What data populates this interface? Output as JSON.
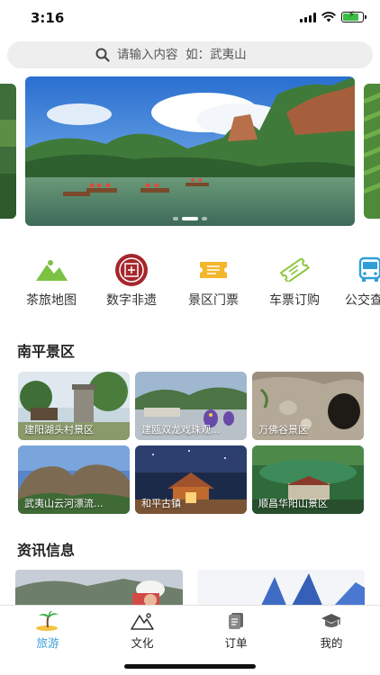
{
  "status_bar": {
    "time": "3:16",
    "battery_level": 0.8
  },
  "search": {
    "placeholder": "请输入内容  如：武夷山",
    "icon": "search-icon"
  },
  "banner": {
    "slide_count": 3,
    "active_slide": 1
  },
  "quick_nav": {
    "items": [
      {
        "label": "茶旅地图",
        "icon": "tea-map-icon",
        "color": "#6dbb3c"
      },
      {
        "label": "数字非遗",
        "icon": "heritage-seal-icon",
        "color": "#a6262c"
      },
      {
        "label": "景区门票",
        "icon": "ticket-icon",
        "color": "#f4b62b"
      },
      {
        "label": "车票订购",
        "icon": "bus-ticket-icon",
        "color": "#8cc63f"
      },
      {
        "label": "公交查",
        "icon": "bus-icon",
        "color": "#2f9fd8"
      }
    ]
  },
  "sections": {
    "scenic_title": "南平景区",
    "news_title": "资讯信息"
  },
  "scenic_spots": [
    {
      "name": "建阳湖头村景区"
    },
    {
      "name": "建瓯双龙戏珠观..."
    },
    {
      "name": "万佛谷景区"
    },
    {
      "name": "武夷山云河漂流..."
    },
    {
      "name": "和平古镇"
    },
    {
      "name": "顺昌华阳山景区"
    }
  ],
  "tab_bar": {
    "tabs": [
      {
        "label": "旅游",
        "icon": "palm-tree-icon",
        "active": true
      },
      {
        "label": "文化",
        "icon": "mountain-icon",
        "active": false
      },
      {
        "label": "订单",
        "icon": "order-icon",
        "active": false
      },
      {
        "label": "我的",
        "icon": "graduation-cap-icon",
        "active": false
      }
    ],
    "active_color": "#3aa0d8"
  }
}
